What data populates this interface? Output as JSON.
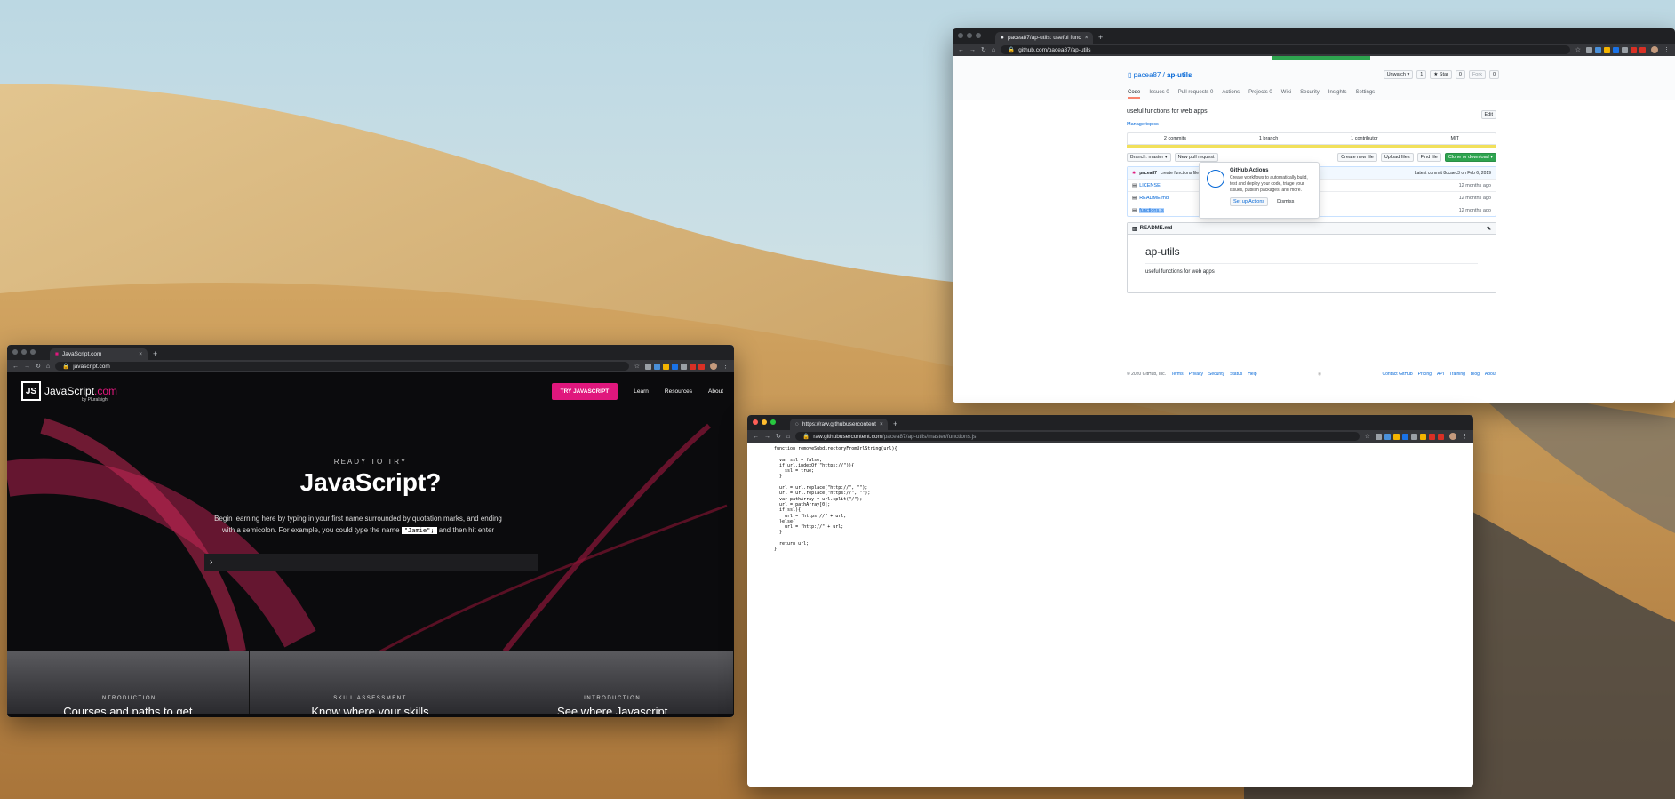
{
  "github_window": {
    "tab_title": "pacea87/ap-utils: useful func",
    "url": "github.com/pacea87/ap-utils",
    "repo_owner": "pacea87",
    "repo_name": "ap-utils",
    "unwatch": "Unwatch ▾",
    "unwatch_count": "1",
    "star": "★ Star",
    "star_count": "0",
    "fork": "Fork",
    "fork_count": "0",
    "tabs": [
      "Code",
      "Issues 0",
      "Pull requests 0",
      "Actions",
      "Projects 0",
      "Wiki",
      "Security",
      "Insights",
      "Settings"
    ],
    "description": "useful functions for web apps",
    "edit": "Edit",
    "manage_topics": "Manage topics",
    "summary": [
      "2 commits",
      "1 branch",
      "1 contributor",
      "MIT"
    ],
    "branch_label": "Branch: master ▾",
    "new_pr": "New pull request",
    "create_file": "Create new file",
    "upload_files": "Upload files",
    "find_file": "Find file",
    "clone": "Clone or download ▾",
    "latest_commit_user": "pacea87",
    "latest_commit_msg": "create functions file.",
    "latest_commit_meta": "Latest commit 8ccaec3 on Feb 6, 2019",
    "files": [
      {
        "name": "LICENSE",
        "msg": "Initial commit",
        "age": "12 months ago"
      },
      {
        "name": "README.md",
        "msg": "Initial commit",
        "age": "12 months ago"
      },
      {
        "name": "functions.js",
        "msg": "create functions file.",
        "age": "12 months ago"
      }
    ],
    "readme_label": "README.md",
    "readme_title": "ap-utils",
    "readme_text": "useful functions for web apps",
    "footer_copy": "© 2020 GitHub, Inc.",
    "footer_left": [
      "Terms",
      "Privacy",
      "Security",
      "Status",
      "Help"
    ],
    "footer_right": [
      "Contact GitHub",
      "Pricing",
      "API",
      "Training",
      "Blog",
      "About"
    ],
    "popover_title": "GitHub Actions",
    "popover_text": "Create workflows to automatically build, test and deploy your code, triage your issues, publish packages, and more.",
    "popover_setup": "Set up Actions",
    "popover_dismiss": "Dismiss"
  },
  "js_window": {
    "tab_title": "JavaScript.com",
    "url": "javascript.com",
    "brand": "JavaScript",
    "brand_suffix": ".com",
    "by": "by Pluralsight",
    "try_button": "TRY JAVASCRIPT",
    "nav": [
      "Learn",
      "Resources",
      "About"
    ],
    "ready": "READY TO TRY",
    "headline": "JavaScript?",
    "para_1": "Begin learning here by typing in your first name surrounded by quotation marks, and ending with a semicolon. For example, you could type the name",
    "code_sample": "\"Jamie\";",
    "para_2": "and then hit enter",
    "prompt": "›",
    "cards": [
      {
        "tag": "INTRODUCTION",
        "caption": "Courses and paths to get"
      },
      {
        "tag": "SKILL ASSESSMENT",
        "caption": "Know where your skills"
      },
      {
        "tag": "INTRODUCTION",
        "caption": "See where Javascript"
      }
    ]
  },
  "raw_window": {
    "tab_title": "https://raw.githubusercontent",
    "url_host": "raw.githubusercontent.com",
    "url_path": "/pacea87/ap-utils/master/functions.js",
    "code": "function removeSubdirectoryFromUrlString(url){\n\n  var ssl = false;\n  if(url.indexOf(\"https://\")){\n    ssl = true;\n  }\n\n  url = url.replace(\"http://\", \"\");\n  url = url.replace(\"https://\", \"\");\n  var pathArray = url.split(\"/\");\n  url = pathArray[0];\n  if(ssl){\n    url = \"https://\" + url;\n  }else{\n    url = \"http://\" + url;\n  }\n\n  return url;\n}"
  },
  "colors": {
    "github_green": "#2ea44f",
    "github_link": "#0366d6",
    "js_pink": "#e0177d",
    "chrome_dark": "#202124"
  }
}
